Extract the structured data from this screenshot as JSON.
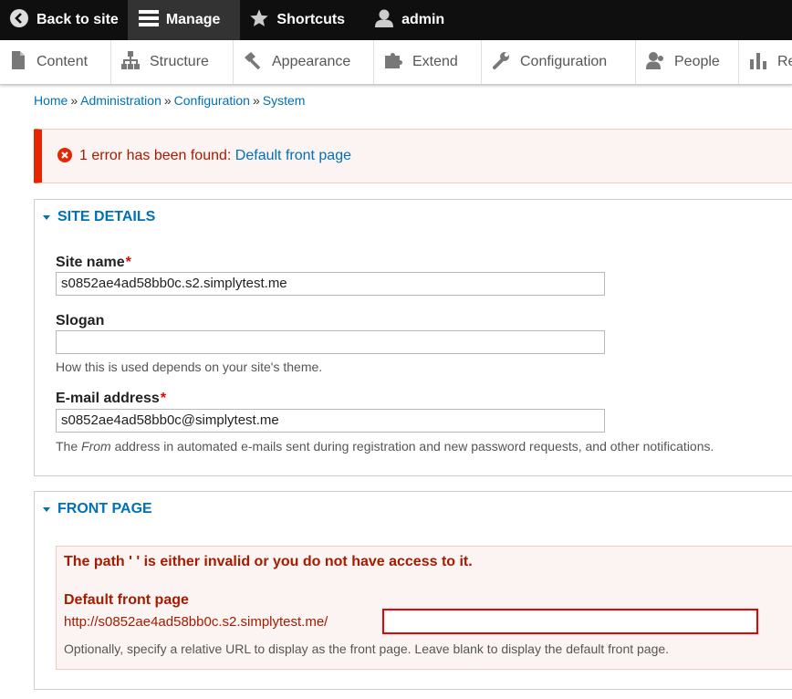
{
  "toolbar": {
    "back": "Back to site",
    "manage": "Manage",
    "shortcuts": "Shortcuts",
    "user": "admin"
  },
  "tray": {
    "items": [
      "Content",
      "Structure",
      "Appearance",
      "Extend",
      "Configuration",
      "People",
      "Reports"
    ]
  },
  "breadcrumb": [
    "Home",
    "Administration",
    "Configuration",
    "System"
  ],
  "breadcrumb_separator": "»",
  "message": {
    "text": "1 error has been found:",
    "link": "Default front page"
  },
  "site_details": {
    "legend": "SITE DETAILS",
    "site_name_label": "Site name",
    "site_name_value": "s0852ae4ad58bb0c.s2.simplytest.me",
    "slogan_label": "Slogan",
    "slogan_value": "",
    "slogan_desc": "How this is used depends on your site's theme.",
    "email_label": "E-mail address",
    "email_value": "s0852ae4ad58bb0c@simplytest.me",
    "email_desc_pre": "The",
    "email_desc_em": "From",
    "email_desc_post": "address in automated e-mails sent during registration and new password requests, and other notifications.",
    "required_mark": "*"
  },
  "front_page": {
    "legend": "FRONT PAGE",
    "error": "The path ' ' is either invalid or you do not have access to it.",
    "label": "Default front page",
    "prefix": "http://s0852ae4ad58bb0c.s2.simplytest.me/",
    "value": "",
    "desc": "Optionally, specify a relative URL to display as the front page. Leave blank to display the default front page."
  },
  "colors": {
    "link": "#0071b8",
    "error_text": "#a51b00",
    "error_border": "#e62600",
    "toolbar_bg": "#0f0f0f"
  }
}
